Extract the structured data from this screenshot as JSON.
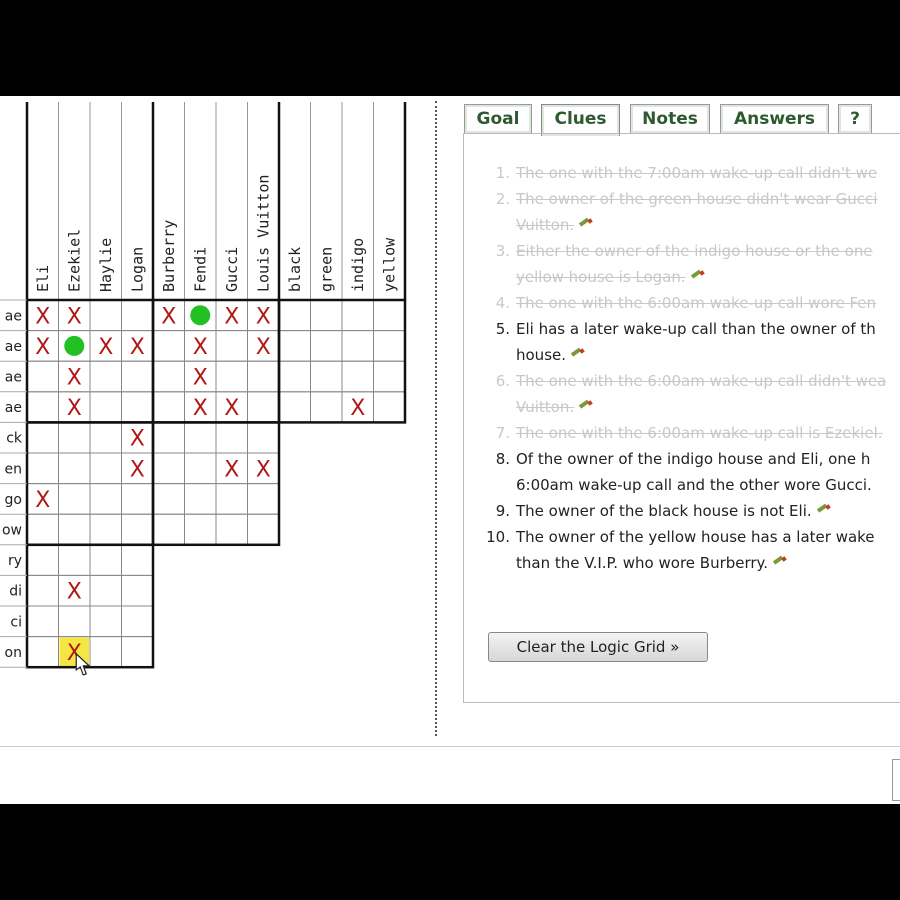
{
  "grid": {
    "person_names": [
      "Eli",
      "Ezekiel",
      "Haylie",
      "Logan"
    ],
    "brand_names": [
      "Burberry",
      "Fendi",
      "Gucci",
      "Louis Vuitton"
    ],
    "color_names": [
      "black",
      "green",
      "indigo",
      "yellow"
    ],
    "row_labels": [
      "ae",
      "ae",
      "ae",
      "ae",
      "ck",
      "en",
      "go",
      "ow",
      "ry",
      "di",
      "ci",
      "on"
    ],
    "x_mark": "X",
    "marks": [
      {
        "r": 0,
        "c": 0,
        "t": "x"
      },
      {
        "r": 0,
        "c": 1,
        "t": "x"
      },
      {
        "r": 0,
        "c": 4,
        "t": "x"
      },
      {
        "r": 0,
        "c": 5,
        "t": "o"
      },
      {
        "r": 0,
        "c": 6,
        "t": "x"
      },
      {
        "r": 0,
        "c": 7,
        "t": "x"
      },
      {
        "r": 1,
        "c": 0,
        "t": "x"
      },
      {
        "r": 1,
        "c": 1,
        "t": "o"
      },
      {
        "r": 1,
        "c": 2,
        "t": "x"
      },
      {
        "r": 1,
        "c": 3,
        "t": "x"
      },
      {
        "r": 1,
        "c": 5,
        "t": "x"
      },
      {
        "r": 1,
        "c": 7,
        "t": "x"
      },
      {
        "r": 2,
        "c": 1,
        "t": "x"
      },
      {
        "r": 2,
        "c": 5,
        "t": "x"
      },
      {
        "r": 3,
        "c": 1,
        "t": "x"
      },
      {
        "r": 3,
        "c": 5,
        "t": "x"
      },
      {
        "r": 3,
        "c": 6,
        "t": "x"
      },
      {
        "r": 3,
        "c": 10,
        "t": "x"
      },
      {
        "r": 4,
        "c": 3,
        "t": "x"
      },
      {
        "r": 5,
        "c": 3,
        "t": "x"
      },
      {
        "r": 5,
        "c": 6,
        "t": "x"
      },
      {
        "r": 5,
        "c": 7,
        "t": "x"
      },
      {
        "r": 6,
        "c": 0,
        "t": "x"
      },
      {
        "r": 9,
        "c": 1,
        "t": "x"
      },
      {
        "r": 11,
        "c": 1,
        "t": "x",
        "highlight": true
      }
    ],
    "highlight_color": "#f5e642",
    "x_color": "#b01818",
    "o_color": "#22c022"
  },
  "tabs": [
    {
      "label": "Goal",
      "active": false
    },
    {
      "label": "Clues",
      "active": true
    },
    {
      "label": "Notes",
      "active": false
    },
    {
      "label": "Answers",
      "active": false
    },
    {
      "label": "?",
      "active": false
    }
  ],
  "clues": [
    {
      "num": "1.",
      "lines": [
        "The one with the 7:00am wake-up call didn't we"
      ],
      "done": true,
      "pencil": false
    },
    {
      "num": "2.",
      "lines": [
        "The owner of the green house didn't wear Gucci",
        "Vuitton."
      ],
      "done": true,
      "pencil": true
    },
    {
      "num": "3.",
      "lines": [
        "Either the owner of the indigo house or the one",
        "yellow house is Logan."
      ],
      "done": true,
      "pencil": true
    },
    {
      "num": "4.",
      "lines": [
        "The one with the 6:00am wake-up call wore Fen"
      ],
      "done": true,
      "pencil": false
    },
    {
      "num": "5.",
      "lines": [
        "Eli has a later wake-up call than the owner of th",
        "house."
      ],
      "done": false,
      "pencil": true
    },
    {
      "num": "6.",
      "lines": [
        "The one with the 6:00am wake-up call didn't wea",
        "Vuitton."
      ],
      "done": true,
      "pencil": true
    },
    {
      "num": "7.",
      "lines": [
        "The one with the 6:00am wake-up call is Ezekiel."
      ],
      "done": true,
      "pencil": false
    },
    {
      "num": "8.",
      "lines": [
        "Of the owner of the indigo house and Eli, one h",
        "6:00am wake-up call and the other wore Gucci."
      ],
      "done": false,
      "pencil": false
    },
    {
      "num": "9.",
      "lines": [
        "The owner of the black house is not Eli."
      ],
      "done": false,
      "pencil": true
    },
    {
      "num": "10.",
      "lines": [
        "The owner of the yellow house has a later wake",
        "than the V.I.P. who wore Burberry."
      ],
      "done": false,
      "pencil": true
    }
  ],
  "clear_button_label": "Clear the Logic Grid »"
}
